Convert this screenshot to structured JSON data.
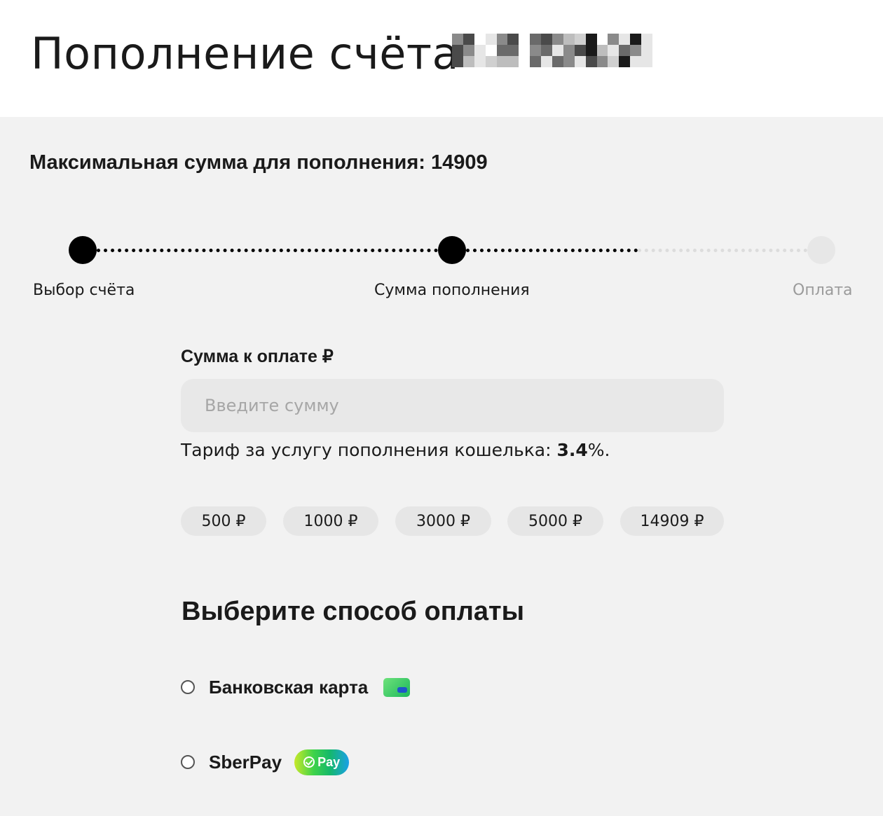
{
  "header": {
    "title": "Пополнение счёта",
    "account_number": "[redacted]"
  },
  "max_sum": {
    "text": "Максимальная сумма для пополнения: 14909"
  },
  "stepper": {
    "progress_step": 2,
    "total_steps": 3,
    "steps": [
      {
        "label": "Выбор счёта",
        "state": "done"
      },
      {
        "label": "Сумма пополнения",
        "state": "active"
      },
      {
        "label": "Оплата",
        "state": "pending"
      }
    ]
  },
  "amount": {
    "label": "Сумма к оплате ₽",
    "placeholder": "Введите сумму",
    "value": "",
    "tariff_prefix": "Тариф за услугу пополнения кошелька: ",
    "tariff_value": "3.4",
    "tariff_suffix": "%."
  },
  "quick_amounts": [
    "500 ₽",
    "1000 ₽",
    "3000 ₽",
    "5000 ₽",
    "14909 ₽"
  ],
  "payment": {
    "title": "Выберите способ оплаты",
    "methods": [
      {
        "label": "Банковская карта",
        "icon": "bank-card-icon",
        "selected": false
      },
      {
        "label": "SberPay",
        "icon": "sberpay-icon",
        "badge": "Pay",
        "selected": false
      }
    ]
  },
  "colors": {
    "page_bg": "#f2f2f2",
    "header_bg": "#ffffff",
    "step_done": "#000000",
    "step_pending": "#e7e7e7",
    "chip_bg": "#e6e6e6",
    "input_bg": "#e8e8e8"
  }
}
